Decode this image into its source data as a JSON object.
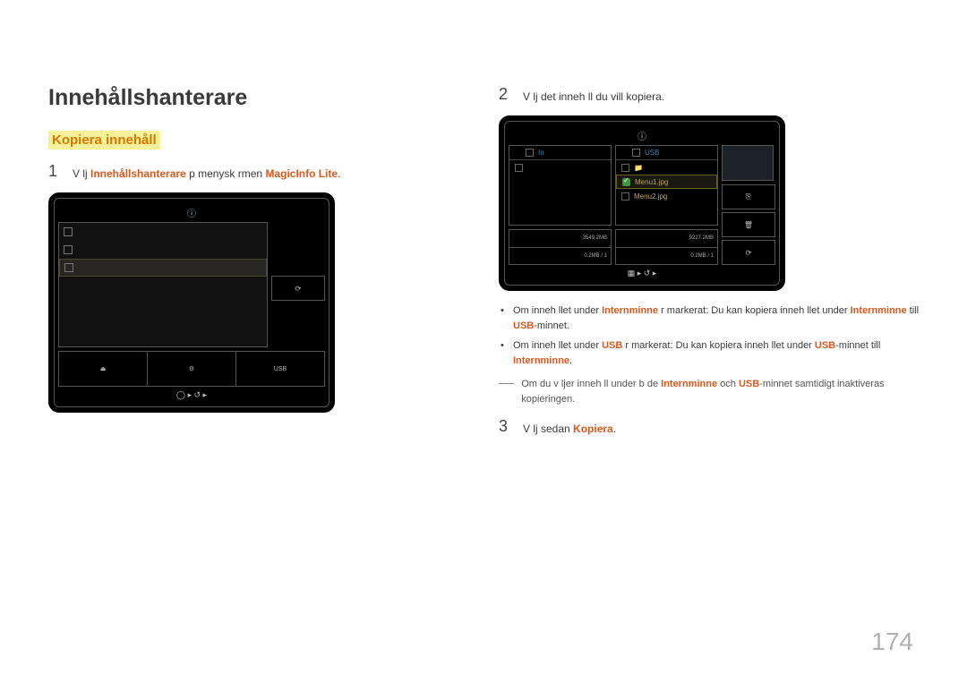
{
  "page_number": "174",
  "title": "Innehållshanterare",
  "subtitle": "Kopiera innehåll",
  "step1": {
    "num": "1",
    "pre": "V lj ",
    "hl1": "Innehållshanterare",
    "mid": " p  menysk rmen ",
    "hl2": "MagicInfo Lite",
    "suf": "."
  },
  "device1": {
    "foot_usb": "USB"
  },
  "step2": {
    "num": "2",
    "text": "V lj det inneh ll du vill kopiera."
  },
  "device2": {
    "tab_left": "In",
    "tab_right": "USB",
    "file1": "Menu1.jpg",
    "file2": "Menu2.jpg",
    "stat_l1": "3549.2MB",
    "stat_l2": "0.2MB / 1",
    "stat_r1": "9227.2MB",
    "stat_r2": "0.2MB / 1"
  },
  "bullet1": {
    "p1": "Om inneh llet under ",
    "hl1": "Internminne",
    "p2": "  r markerat: Du kan kopiera inneh llet under ",
    "hl2": "Internminne",
    "p3": " till ",
    "hl3": "USB",
    "p4": "-minnet."
  },
  "bullet2": {
    "p1": "Om inneh llet under ",
    "hl1": "USB",
    "p2": "  r markerat: Du kan kopiera inneh llet under ",
    "hl2": "USB",
    "p3": "-minnet till ",
    "hl3": "Internminne",
    "p4": "."
  },
  "note": {
    "p1": "Om du v ljer inneh ll under b de ",
    "hl1": "Internminne",
    "p2": " och ",
    "hl2": "USB",
    "p3": "-minnet samtidigt inaktiveras kopieringen."
  },
  "step3": {
    "num": "3",
    "pre": "V lj sedan ",
    "hl1": "Kopiera",
    "suf": "."
  }
}
